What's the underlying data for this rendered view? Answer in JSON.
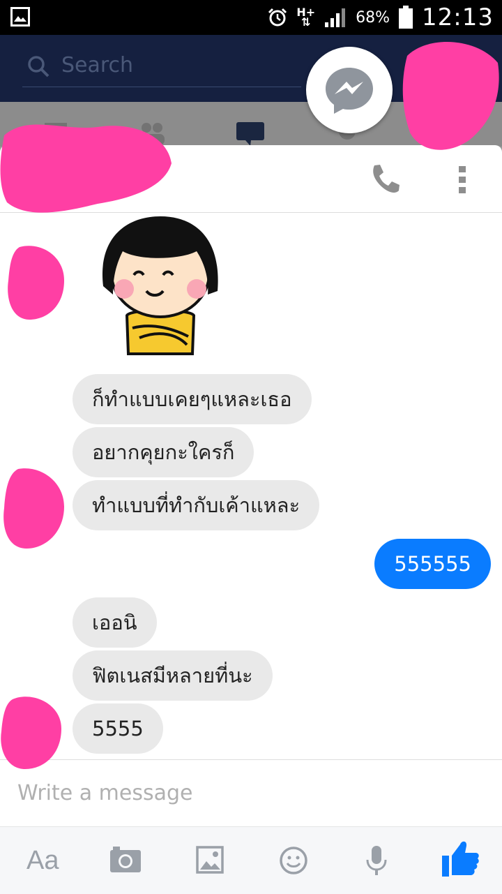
{
  "status_bar": {
    "network": "H+",
    "battery": "68%",
    "time": "12:13"
  },
  "header": {
    "search_placeholder": "Search"
  },
  "messages": [
    {
      "side": "them",
      "text": "ก็ทำแบบเคยๆแหละเธอ"
    },
    {
      "side": "them",
      "text": "อยากคุยกะใครก็"
    },
    {
      "side": "them",
      "text": "ทำแบบที่ทำกับเค้าแหละ"
    },
    {
      "side": "me",
      "text": "555555"
    },
    {
      "side": "them",
      "text": "เออนิ"
    },
    {
      "side": "them",
      "text": "ฟิตเนสมีหลายที่นะ"
    },
    {
      "side": "them",
      "text": "5555"
    }
  ],
  "composer": {
    "placeholder": "Write a message"
  },
  "toolbar": {
    "text_button": "Aa",
    "items": [
      "camera-icon",
      "image-icon",
      "emoji-icon",
      "microphone-icon",
      "like-icon"
    ]
  },
  "colors": {
    "accent": "#0a7cff",
    "bubble_them": "#e9e9e9",
    "redaction": "#ff3fa4",
    "header": "#152040"
  }
}
